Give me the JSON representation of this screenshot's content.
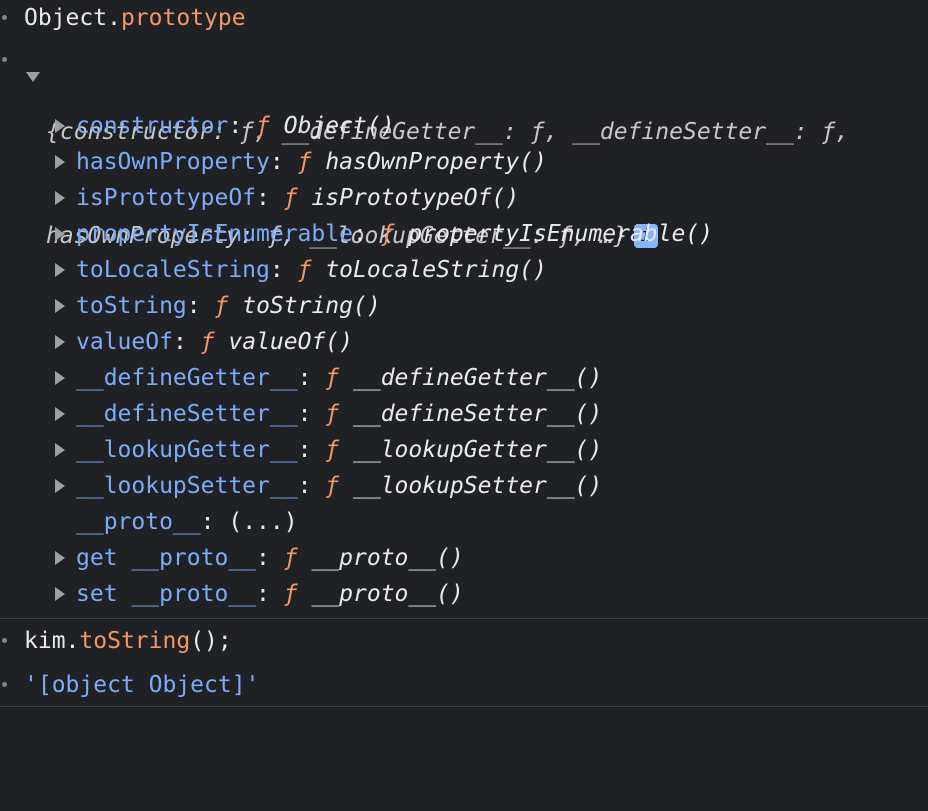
{
  "entries": {
    "cmd1": {
      "object": "Object",
      "dot": ".",
      "prop": "prototype"
    },
    "summary": {
      "line1": "{constructor: ƒ, __defineGetter__: ƒ, __defineSetter__: ƒ,",
      "line2": "hasOwnProperty: ƒ, __lookupGetter__: ƒ, …}",
      "info": "i"
    },
    "rows": [
      {
        "key": "constructor",
        "colon": ":",
        "f": "ƒ",
        "value": "Object()"
      },
      {
        "key": "hasOwnProperty",
        "colon": ":",
        "f": "ƒ",
        "value": "hasOwnProperty()"
      },
      {
        "key": "isPrototypeOf",
        "colon": ":",
        "f": "ƒ",
        "value": "isPrototypeOf()"
      },
      {
        "key": "propertyIsEnumerable",
        "colon": ":",
        "f": "ƒ",
        "value": "propertyIsEnumerable()"
      },
      {
        "key": "toLocaleString",
        "colon": ":",
        "f": "ƒ",
        "value": "toLocaleString()"
      },
      {
        "key": "toString",
        "colon": ":",
        "f": "ƒ",
        "value": "toString()"
      },
      {
        "key": "valueOf",
        "colon": ":",
        "f": "ƒ",
        "value": "valueOf()"
      },
      {
        "key": "__defineGetter__",
        "colon": ":",
        "f": "ƒ",
        "value": "__defineGetter__()"
      },
      {
        "key": "__defineSetter__",
        "colon": ":",
        "f": "ƒ",
        "value": "__defineSetter__()"
      },
      {
        "key": "__lookupGetter__",
        "colon": ":",
        "f": "ƒ",
        "value": "__lookupGetter__()"
      },
      {
        "key": "__lookupSetter__",
        "colon": ":",
        "f": "ƒ",
        "value": "__lookupSetter__()"
      }
    ],
    "proto_row": {
      "key": "__proto__",
      "colon": ":",
      "value": "(...)"
    },
    "getter_rows": [
      {
        "key": "get __proto__",
        "colon": ":",
        "f": "ƒ",
        "value": "__proto__()"
      },
      {
        "key": "set __proto__",
        "colon": ":",
        "f": "ƒ",
        "value": "__proto__()"
      }
    ],
    "cmd2": {
      "object": "kim",
      "dot": ".",
      "method": "toString",
      "rest": "();"
    },
    "result2": {
      "value": "'[object Object]'"
    }
  },
  "colors": {
    "background": "#202124",
    "text": "#e8eaed",
    "property_key": "#7cacf8",
    "function_marker": "#f29766",
    "muted": "#9aa0a6",
    "separator": "#3c4043"
  },
  "icons": {
    "expanded": "triangle-down-icon",
    "collapsed": "triangle-right-icon",
    "info": "info-icon"
  }
}
